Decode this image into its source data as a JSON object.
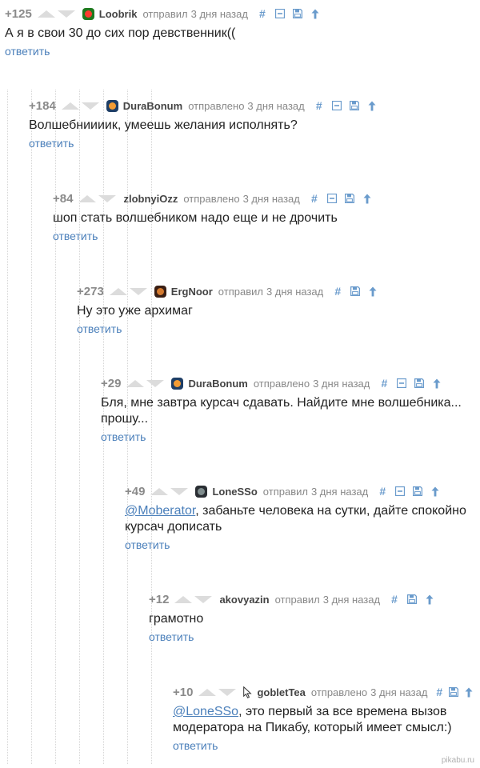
{
  "comments": [
    {
      "rating": "+125",
      "user": "Loobrik",
      "verb": "отправил",
      "time": "3 дня назад",
      "icons": [
        "hash-icon",
        "collapse-icon",
        "save-icon",
        "arrow-up-icon"
      ],
      "parts": [
        {
          "t": "А я в свои 30 до сих пор девственник(("
        }
      ],
      "reply": "ответить",
      "avatar": "#1f7a1f",
      "avatar_inner": "#ff3b2f"
    },
    {
      "rating": "+184",
      "user": "DuraBonum",
      "verb": "отправлено",
      "time": "3 дня назад",
      "icons": [
        "hash-icon",
        "collapse-icon",
        "save-icon",
        "arrow-up-icon"
      ],
      "parts": [
        {
          "t": "Волшебниииик, умеешь желания исполнять?"
        }
      ],
      "reply": "ответить",
      "avatar": "#1e3e66",
      "avatar_inner": "#f39c34"
    },
    {
      "rating": "+84",
      "user": "zlobnyiOzz",
      "verb": "отправлено",
      "time": "3 дня назад",
      "icons": [
        "hash-icon",
        "collapse-icon",
        "save-icon",
        "arrow-up-icon"
      ],
      "parts": [
        {
          "t": "шоп стать волшебником надо еще и не дрочить"
        }
      ],
      "reply": "ответить"
    },
    {
      "rating": "+273",
      "user": "ErgNoor",
      "verb": "отправил",
      "time": "3 дня назад",
      "icons": [
        "hash-icon",
        "save-icon",
        "arrow-up-icon"
      ],
      "parts": [
        {
          "t": "Ну это уже архимаг"
        }
      ],
      "reply": "ответить",
      "avatar": "#3a1f14",
      "avatar_inner": "#d47a2f"
    },
    {
      "rating": "+29",
      "user": "DuraBonum",
      "verb": "отправлено",
      "time": "3 дня назад",
      "icons": [
        "hash-icon",
        "collapse-icon",
        "save-icon",
        "arrow-up-icon"
      ],
      "parts": [
        {
          "t": "Бля, мне завтра курсач сдавать. Найдите мне волшебника... прошу..."
        }
      ],
      "reply": "ответить",
      "avatar": "#1e3e66",
      "avatar_inner": "#f39c34"
    },
    {
      "rating": "+49",
      "user": "LoneSSo",
      "verb": "отправил",
      "time": "3 дня назад",
      "icons": [
        "hash-icon",
        "collapse-icon",
        "save-icon",
        "arrow-up-icon"
      ],
      "parts": [
        {
          "t": "@Moberator",
          "mention": true
        },
        {
          "t": ", забаньте человека на сутки, дайте спокойно курсач дописать"
        }
      ],
      "reply": "ответить",
      "avatar": "#2a2e33",
      "avatar_inner": "#7f8c8d"
    },
    {
      "rating": "+12",
      "user": "akovyazin",
      "verb": "отправил",
      "time": "3 дня назад",
      "icons": [
        "hash-icon",
        "save-icon",
        "arrow-up-icon"
      ],
      "parts": [
        {
          "t": "грамотно"
        }
      ],
      "reply": "ответить"
    },
    {
      "rating": "+10",
      "user": "gobletTea",
      "verb": "отправлено",
      "time": "3 дня назад",
      "icons": [
        "hash-icon",
        "save-icon",
        "arrow-up-icon"
      ],
      "parts": [
        {
          "t": "@LoneSSo",
          "mention": true
        },
        {
          "t": ", это первый за все времена вызов модератора на Пикабу, который имеет смысл:)"
        }
      ],
      "reply": "ответить",
      "cursor": true
    }
  ],
  "colors": {
    "link": "#4a7fba",
    "icon": "#6a9bcc",
    "arrow": "#dcdcdc",
    "rating": "#8a8a8a"
  },
  "watermark": "pikabu.ru"
}
